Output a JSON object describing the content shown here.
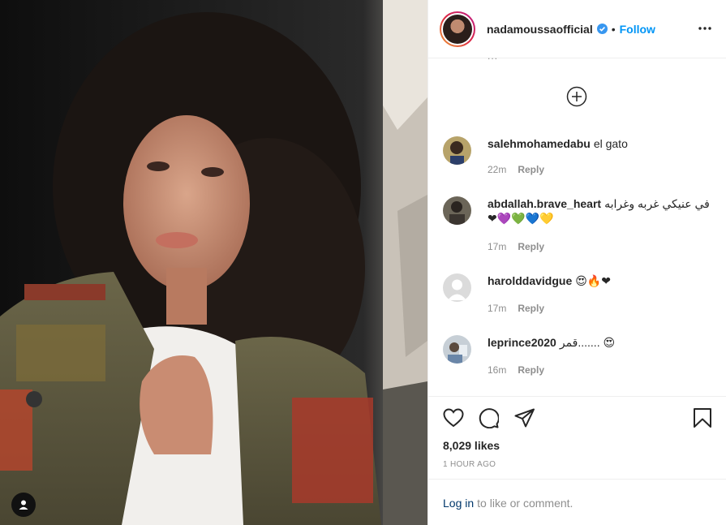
{
  "post": {
    "author": "nadamoussaofficial",
    "follow_label": "Follow",
    "dot": "•",
    "comments_ellipsis": "...",
    "likes": "8,029 likes",
    "timestamp": "1 HOUR AGO",
    "login_link": "Log in",
    "login_rest": "to like or comment."
  },
  "comments": [
    {
      "username": "salehmohamedabu",
      "text": "el gato",
      "age": "22m",
      "reply": "Reply"
    },
    {
      "username": "abdallah.brave_heart",
      "text": "في عنيكي غربه وغرابه ❤💜💚💙💛",
      "age": "17m",
      "reply": "Reply"
    },
    {
      "username": "harolddavidgue",
      "text": "😍🔥❤",
      "age": "17m",
      "reply": "Reply"
    },
    {
      "username": "leprince2020",
      "text": "قمر....... 😍",
      "age": "16m",
      "reply": "Reply"
    }
  ],
  "icons": {
    "more": "more-options-icon",
    "load_more": "load-more-comments-icon",
    "like": "heart-icon",
    "comment": "comment-icon",
    "share": "share-icon",
    "save": "bookmark-icon",
    "tag": "user-tag-icon"
  },
  "colors": {
    "accent": "#0095f6",
    "text": "#262626",
    "muted": "#8e8e8e",
    "link": "#00376b"
  }
}
